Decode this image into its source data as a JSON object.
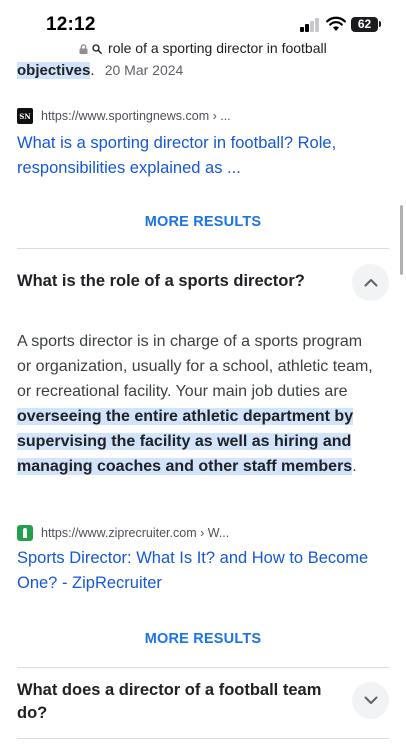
{
  "status_bar": {
    "time": "12:12",
    "battery": "62"
  },
  "url_bar": {
    "text": "role of a sporting director in football"
  },
  "snippet_tail": {
    "highlight": "objectives",
    "punct": ".",
    "date": "20 Mar 2024"
  },
  "result1": {
    "url": "https://www.sportingnews.com › ...",
    "favicon_text": "SN",
    "title": "What is a sporting director in football? Role, responsibilities explained as ..."
  },
  "more_results_label": "MORE RESULTS",
  "faq1": {
    "question": "What is the role of a sports director?",
    "answer_plain": "A sports director is in charge of a sports program or organization, usually for a school, athletic team, or recreational facility. Your main job duties are ",
    "answer_highlight": "overseeing the entire athletic department by supervising the facility as well as hiring and managing coaches and other staff members",
    "answer_end": "."
  },
  "result2": {
    "url": "https://www.ziprecruiter.com › W...",
    "title": "Sports Director: What Is It? and How to Become One? - ZipRecruiter"
  },
  "faq2": {
    "question": "What does a director of a football team do?"
  },
  "colors": {
    "link": "#1558d6",
    "more": "#1a73e8",
    "highlight": "#d2e3fc"
  }
}
